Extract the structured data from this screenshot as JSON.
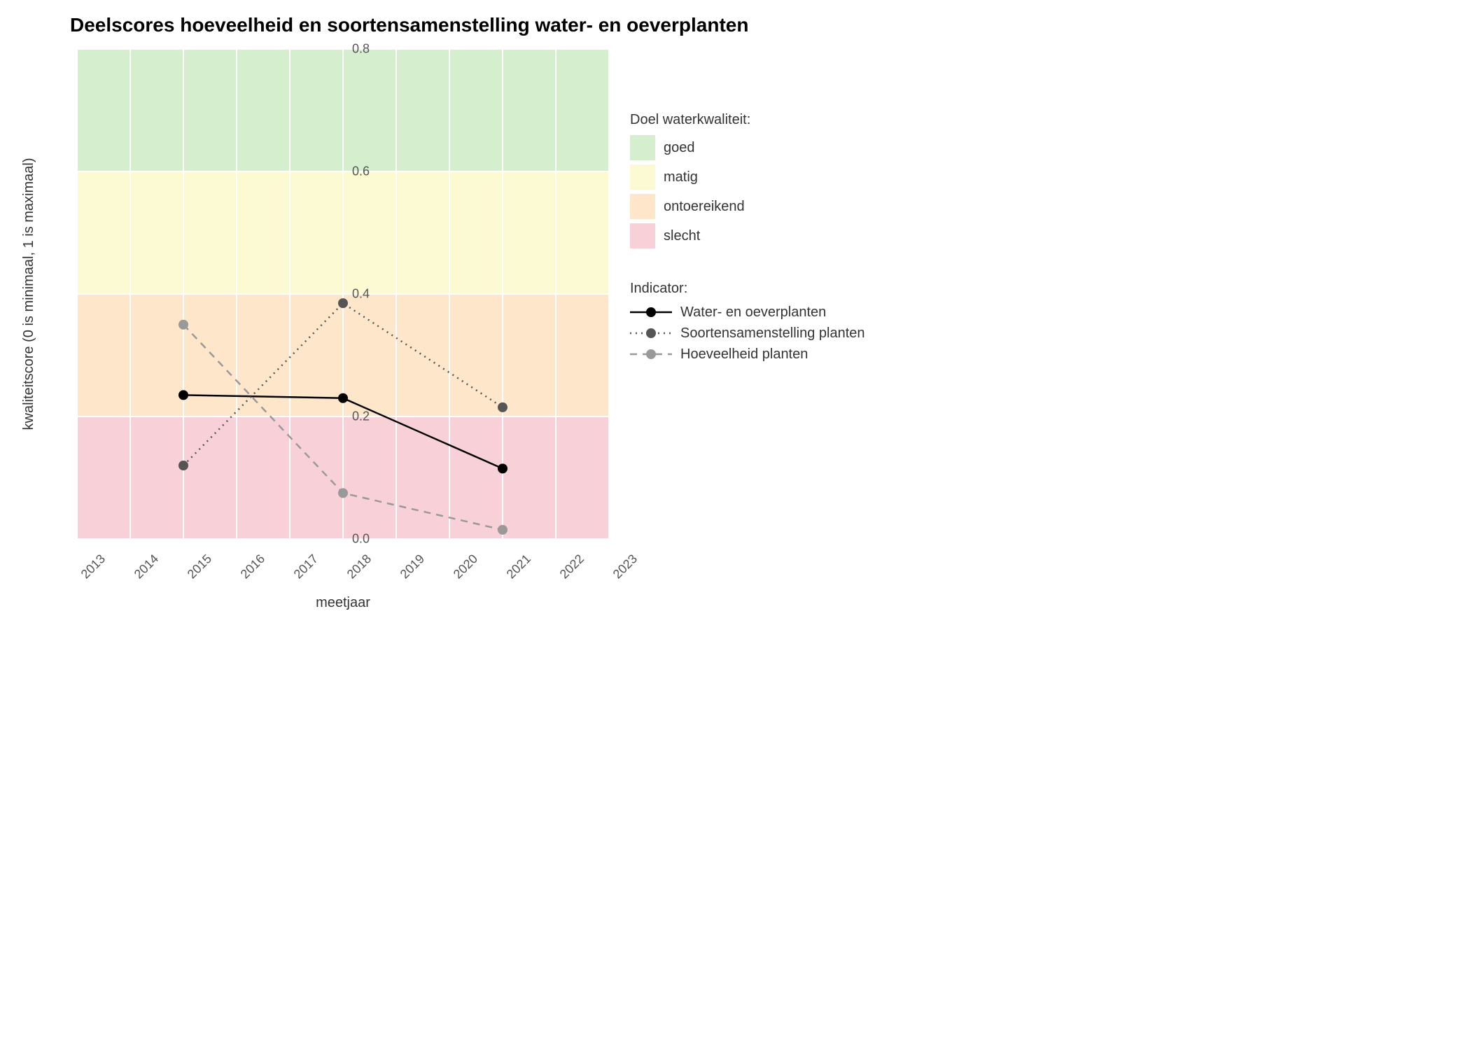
{
  "chart_data": {
    "type": "line",
    "title": "Deelscores hoeveelheid en soortensamenstelling water- en oeverplanten",
    "xlabel": "meetjaar",
    "ylabel": "kwaliteitscore (0 is minimaal, 1 is maximaal)",
    "x_ticks": [
      2013,
      2014,
      2015,
      2016,
      2017,
      2018,
      2019,
      2020,
      2021,
      2022,
      2023
    ],
    "y_ticks": [
      0.0,
      0.2,
      0.4,
      0.6,
      0.8
    ],
    "xlim": [
      2013,
      2023
    ],
    "ylim": [
      0.0,
      0.8
    ],
    "background_bands": {
      "title": "Doel waterkwaliteit:",
      "bands": [
        {
          "label": "goed",
          "from": 0.6,
          "to": 0.8,
          "color": "#d5efce"
        },
        {
          "label": "matig",
          "from": 0.4,
          "to": 0.6,
          "color": "#fbfad2"
        },
        {
          "label": "ontoereikend",
          "from": 0.2,
          "to": 0.4,
          "color": "#fde6ca"
        },
        {
          "label": "slecht",
          "from": 0.0,
          "to": 0.2,
          "color": "#f8d0d8"
        }
      ]
    },
    "series": [
      {
        "name": "Water- en oeverplanten",
        "style": "solid",
        "color": "#000000",
        "point_color": "#000000",
        "x": [
          2015,
          2018,
          2021
        ],
        "y": [
          0.235,
          0.23,
          0.115
        ]
      },
      {
        "name": "Soortensamenstelling planten",
        "style": "dotted",
        "color": "#555555",
        "point_color": "#555555",
        "x": [
          2015,
          2018,
          2021
        ],
        "y": [
          0.12,
          0.385,
          0.215
        ]
      },
      {
        "name": "Hoeveelheid planten",
        "style": "dashed",
        "color": "#999999",
        "point_color": "#999999",
        "x": [
          2015,
          2018,
          2021
        ],
        "y": [
          0.35,
          0.075,
          0.015
        ]
      }
    ],
    "indicator_legend_title": "Indicator:"
  }
}
